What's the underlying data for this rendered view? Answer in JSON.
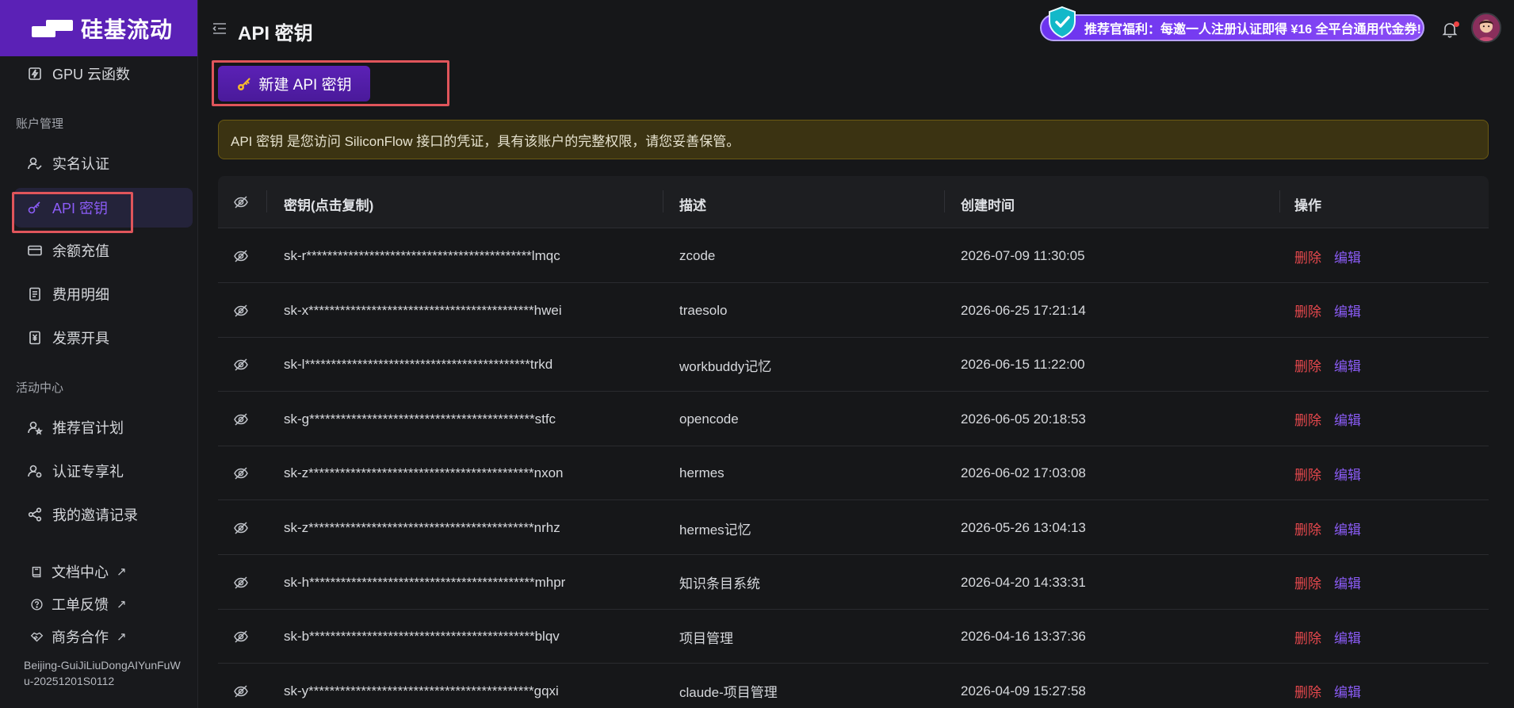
{
  "brand": {
    "name": "硅基流动"
  },
  "sidebar": {
    "top_item": "GPU 云函数",
    "section_account": "账户管理",
    "account_items": [
      "实名认证",
      "API 密钥",
      "余额充值",
      "费用明细",
      "发票开具"
    ],
    "section_activity": "活动中心",
    "activity_items": [
      "推荐官计划",
      "认证专享礼",
      "我的邀请记录"
    ],
    "external_links": [
      "文档中心",
      "工单反馈",
      "商务合作"
    ],
    "external_arrow": "↗",
    "org_id": "Beijing-GuiJiLiuDongAIYunFuWu-20251201S0112"
  },
  "header": {
    "title": "API 密钥",
    "promo": "推荐官福利：每邀一人注册认证即得 ¥16 全平台通用代金券!"
  },
  "actions": {
    "new_key": "新建 API 密钥"
  },
  "notice": "API 密钥 是您访问 SiliconFlow 接口的凭证，具有该账户的完整权限，请您妥善保管。",
  "table": {
    "headers": {
      "key": "密钥(点击复制)",
      "desc": "描述",
      "created": "创建时间",
      "ops": "操作"
    },
    "delete_label": "删除",
    "edit_label": "编辑",
    "rows": [
      {
        "key": "sk-r*******************************************lmqc",
        "desc": "zcode",
        "created": "2026-07-09 11:30:05"
      },
      {
        "key": "sk-x*******************************************hwei",
        "desc": "traesolo",
        "created": "2026-06-25 17:21:14"
      },
      {
        "key": "sk-l*******************************************trkd",
        "desc": "workbuddy记忆",
        "created": "2026-06-15 11:22:00"
      },
      {
        "key": "sk-g*******************************************stfc",
        "desc": "opencode",
        "created": "2026-06-05 20:18:53"
      },
      {
        "key": "sk-z*******************************************nxon",
        "desc": "hermes",
        "created": "2026-06-02 17:03:08"
      },
      {
        "key": "sk-z*******************************************nrhz",
        "desc": "hermes记忆",
        "created": "2026-05-26 13:04:13"
      },
      {
        "key": "sk-h*******************************************mhpr",
        "desc": "知识条目系统",
        "created": "2026-04-20 14:33:31"
      },
      {
        "key": "sk-b*******************************************blqv",
        "desc": "项目管理",
        "created": "2026-04-16 13:37:36"
      },
      {
        "key": "sk-y*******************************************gqxi",
        "desc": "claude-项目管理",
        "created": "2026-04-09 15:27:58"
      }
    ]
  },
  "colors": {
    "accent": "#8b5cf6",
    "brand": "#5b21b6",
    "danger": "#e5484d",
    "highlight": "#e0555b"
  }
}
